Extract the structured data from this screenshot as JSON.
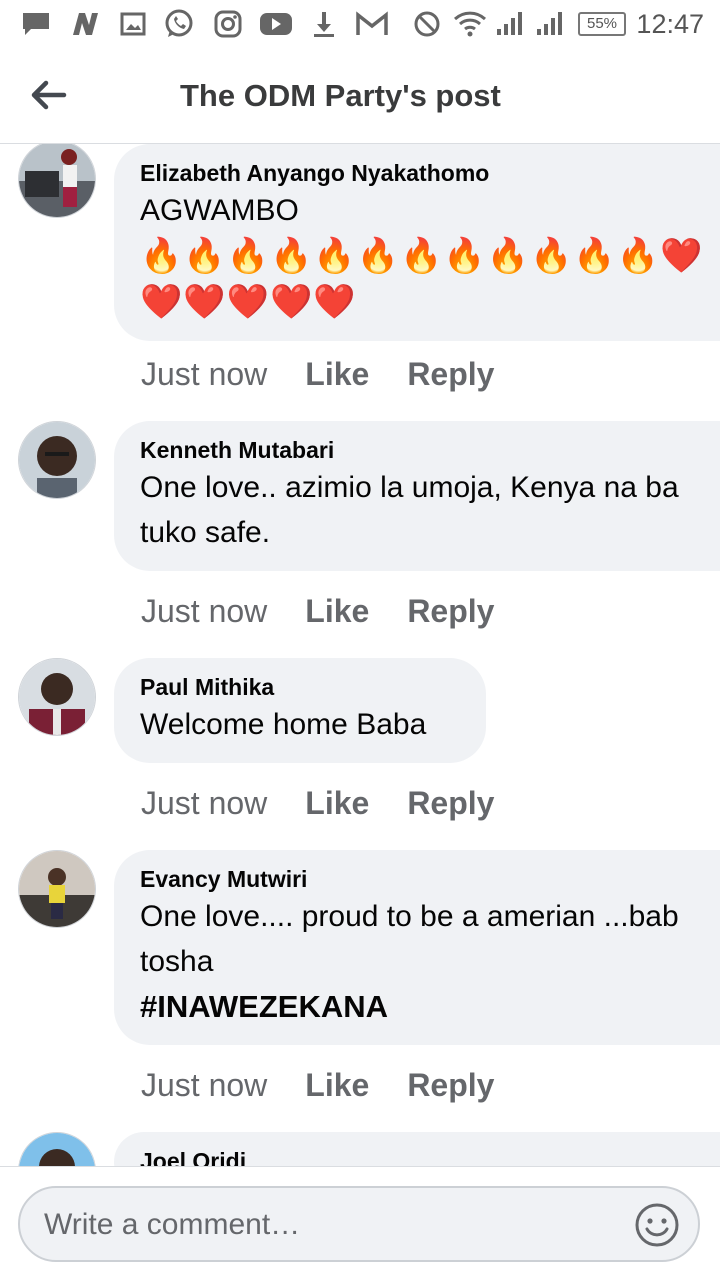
{
  "status_bar": {
    "battery": "55%",
    "time": "12:47",
    "icons": [
      "message-icon",
      "news-icon",
      "gallery-icon",
      "whatsapp-icon",
      "instagram-icon",
      "youtube-icon",
      "download-icon",
      "gmail-icon",
      "dnd-icon",
      "wifi-icon",
      "signal-icon",
      "signal-icon-2",
      "battery-icon"
    ]
  },
  "header": {
    "title": "The ODM Party's post",
    "back_icon": "back-arrow-icon"
  },
  "comments": [
    {
      "name": "Elizabeth Anyango Nyakathomo",
      "text_lines": [
        "AGWAMBO"
      ],
      "emoji_lines": [
        "🔥🔥🔥🔥🔥🔥🔥🔥🔥🔥🔥🔥❤️",
        "❤️❤️❤️❤️❤️"
      ],
      "time": "Just now",
      "like": "Like",
      "reply": "Reply"
    },
    {
      "name": "Kenneth Mutabari",
      "text_lines": [
        "One love.. azimio la umoja, Kenya na ba",
        "tuko safe."
      ],
      "time": "Just now",
      "like": "Like",
      "reply": "Reply"
    },
    {
      "name": "Paul Mithika",
      "text_lines": [
        "Welcome home Baba"
      ],
      "time": "Just now",
      "like": "Like",
      "reply": "Reply"
    },
    {
      "name": "Evancy Mutwiri",
      "text_lines": [
        "One love.... proud to be a amerian ...bab",
        "tosha"
      ],
      "hashtag": "#INAWEZEKANA",
      "time": "Just now",
      "like": "Like",
      "reply": "Reply"
    },
    {
      "name": "Joel Oridi"
    }
  ],
  "composer": {
    "placeholder": "Write a comment…",
    "emoji_icon": "smiley-icon"
  }
}
